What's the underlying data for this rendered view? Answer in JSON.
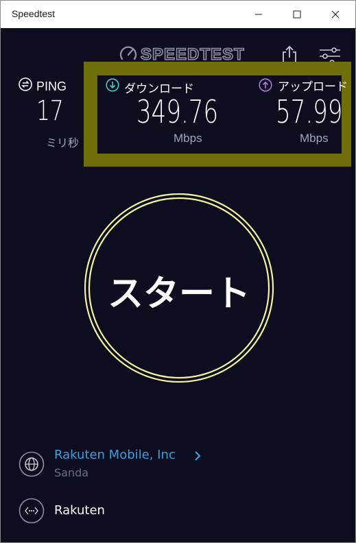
{
  "window": {
    "title": "Speedtest",
    "controls": [
      "minimize-icon",
      "maximize-icon",
      "close-icon"
    ]
  },
  "header": {
    "logo_text": "SPEEDTEST",
    "icons": [
      "share-icon",
      "settings-sliders-icon"
    ]
  },
  "ping": {
    "label": "PING",
    "value": "17",
    "unit": "ミリ秒",
    "icon": "ping-icon"
  },
  "download": {
    "label": "ダウンロード",
    "value": "349.76",
    "unit": "Mbps",
    "icon": "download-arrow-icon",
    "color": "#3fd1c8"
  },
  "upload": {
    "label": "アップロード",
    "value": "57.99",
    "unit": "Mbps",
    "icon": "upload-arrow-icon",
    "color": "#b17ae8"
  },
  "go_button": {
    "label": "スタート",
    "ring_color": "#f6f39c"
  },
  "provider": {
    "name": "Rakuten Mobile, Inc",
    "location": "Sanda",
    "icon": "globe-icon",
    "link_color": "#3d9fe3"
  },
  "server": {
    "name": "Rakuten",
    "icon": "server-dots-icon"
  },
  "colors": {
    "background": "#0c0d1f",
    "highlight": "#706e0b",
    "muted_text": "#a3a5bd"
  }
}
